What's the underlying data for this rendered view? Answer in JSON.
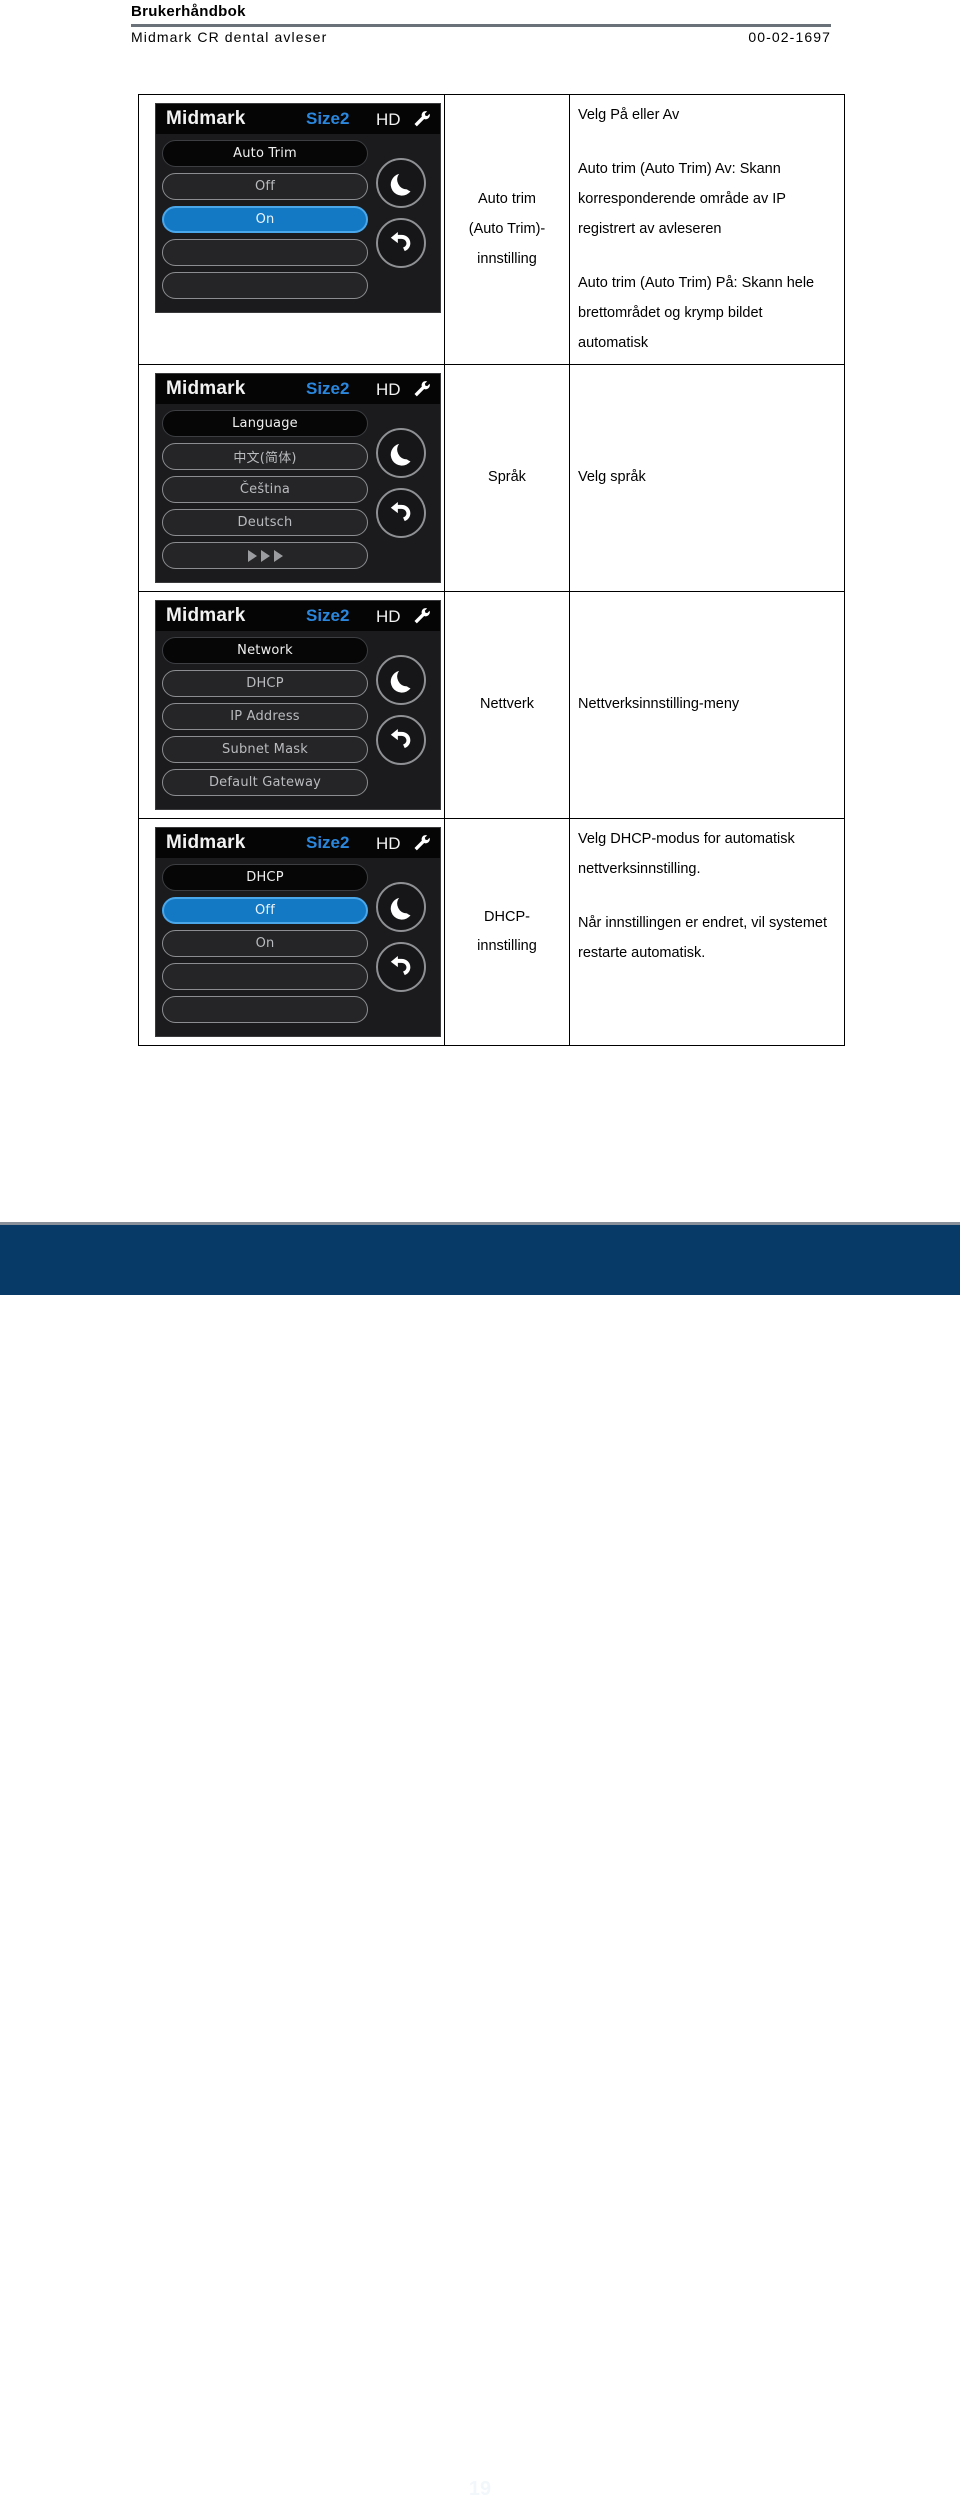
{
  "header": {
    "manual_label": "Brukerhåndbok",
    "product": "Midmark CR dental avleser",
    "doc_number": "00-02-1697"
  },
  "colors": {
    "accent_blue": "#1479c4",
    "title_blue": "#2a87dd",
    "footer_navy": "#083a68",
    "screen_bg": "#1b1b1d"
  },
  "rows": [
    {
      "name": "Auto trim\n(Auto Trim)-\ninnstilling",
      "name_lines": [
        "Auto trim",
        "(Auto Trim)-",
        "innstilling"
      ],
      "description_paragraphs": [
        "Velg På eller Av",
        "Auto trim (Auto Trim) Av: Skann korresponderende område av IP registrert av avleseren",
        "Auto trim (Auto Trim) På: Skann hele brettområdet og krymp bildet automatisk"
      ],
      "screen": {
        "brand": "Midmark",
        "size": "Size2",
        "quality": "HD",
        "tool_icon": "wrench-icon",
        "menu_items": [
          {
            "label": "Auto Trim",
            "type": "header"
          },
          {
            "label": "Off",
            "type": "normal"
          },
          {
            "label": "On",
            "type": "selected"
          },
          {
            "label": "",
            "type": "blank"
          },
          {
            "label": "",
            "type": "blank"
          }
        ],
        "side_buttons": [
          {
            "icon": "moon-icon"
          },
          {
            "icon": "back-arrow-icon"
          }
        ]
      }
    },
    {
      "name": "Språk",
      "name_lines": [
        "Språk"
      ],
      "description_paragraphs": [
        "Velg språk"
      ],
      "screen": {
        "brand": "Midmark",
        "size": "Size2",
        "quality": "HD",
        "tool_icon": "wrench-icon",
        "menu_items": [
          {
            "label": "Language",
            "type": "header"
          },
          {
            "label": "中文(简体)",
            "type": "normal"
          },
          {
            "label": "Čeština",
            "type": "normal"
          },
          {
            "label": "Deutsch",
            "type": "normal"
          },
          {
            "label": "▶▶▶",
            "type": "arrows"
          }
        ],
        "side_buttons": [
          {
            "icon": "moon-icon"
          },
          {
            "icon": "back-arrow-icon"
          }
        ]
      }
    },
    {
      "name": "Nettverk",
      "name_lines": [
        "Nettverk"
      ],
      "description_paragraphs": [
        "Nettverksinnstilling-meny"
      ],
      "screen": {
        "brand": "Midmark",
        "size": "Size2",
        "quality": "HD",
        "tool_icon": "wrench-icon",
        "menu_items": [
          {
            "label": "Network",
            "type": "header"
          },
          {
            "label": "DHCP",
            "type": "normal"
          },
          {
            "label": "IP Address",
            "type": "normal"
          },
          {
            "label": "Subnet Mask",
            "type": "normal"
          },
          {
            "label": "Default Gateway",
            "type": "normal"
          }
        ],
        "side_buttons": [
          {
            "icon": "moon-icon"
          },
          {
            "icon": "back-arrow-icon"
          }
        ]
      }
    },
    {
      "name": "DHCP-\ninnstilling",
      "name_lines": [
        "DHCP-",
        "innstilling"
      ],
      "description_paragraphs": [
        "Velg DHCP-modus for automatisk nettverksinnstilling.",
        "Når innstillingen er endret, vil systemet restarte automatisk."
      ],
      "screen": {
        "brand": "Midmark",
        "size": "Size2",
        "quality": "HD",
        "tool_icon": "wrench-icon",
        "menu_items": [
          {
            "label": "DHCP",
            "type": "header"
          },
          {
            "label": "Off",
            "type": "selected"
          },
          {
            "label": "On",
            "type": "normal"
          },
          {
            "label": "",
            "type": "blank"
          },
          {
            "label": "",
            "type": "blank"
          }
        ],
        "side_buttons": [
          {
            "icon": "moon-icon"
          },
          {
            "icon": "back-arrow-icon"
          }
        ]
      }
    }
  ],
  "footer": {
    "page_number": "19"
  }
}
